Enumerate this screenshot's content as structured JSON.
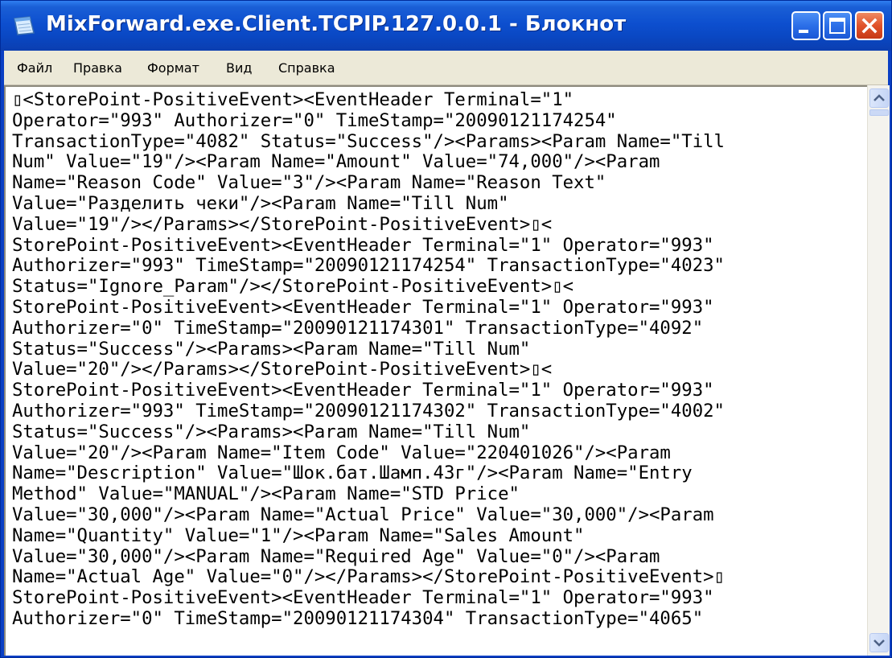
{
  "window": {
    "title": "MixForward.exe.Client.TCPIP.127.0.0.1 - Блокнот"
  },
  "menu": {
    "items": [
      "Файл",
      "Правка",
      "Формат",
      "Вид",
      "Справка"
    ]
  },
  "document": {
    "lines": [
      "▯<StorePoint-PositiveEvent><EventHeader Terminal=\"1\"",
      "Operator=\"993\" Authorizer=\"0\" TimeStamp=\"20090121174254\"",
      "TransactionType=\"4082\" Status=\"Success\"/><Params><Param Name=\"Till",
      "Num\" Value=\"19\"/><Param Name=\"Amount\" Value=\"74,000\"/><Param",
      "Name=\"Reason Code\" Value=\"3\"/><Param Name=\"Reason Text\"",
      "Value=\"Разделить чеки\"/><Param Name=\"Till Num\"",
      "Value=\"19\"/></Params></StorePoint-PositiveEvent>▯<",
      "StorePoint-PositiveEvent><EventHeader Terminal=\"1\" Operator=\"993\"",
      "Authorizer=\"993\" TimeStamp=\"20090121174254\" TransactionType=\"4023\"",
      "Status=\"Ignore_Param\"/></StorePoint-PositiveEvent>▯<",
      "StorePoint-PositiveEvent><EventHeader Terminal=\"1\" Operator=\"993\"",
      "Authorizer=\"0\" TimeStamp=\"20090121174301\" TransactionType=\"4092\"",
      "Status=\"Success\"/><Params><Param Name=\"Till Num\"",
      "Value=\"20\"/></Params></StorePoint-PositiveEvent>▯<",
      "StorePoint-PositiveEvent><EventHeader Terminal=\"1\" Operator=\"993\"",
      "Authorizer=\"993\" TimeStamp=\"20090121174302\" TransactionType=\"4002\"",
      "Status=\"Success\"/><Params><Param Name=\"Till Num\"",
      "Value=\"20\"/><Param Name=\"Item Code\" Value=\"220401026\"/><Param",
      "Name=\"Description\" Value=\"Шок.бат.Шамп.43г\"/><Param Name=\"Entry",
      "Method\" Value=\"MANUAL\"/><Param Name=\"STD Price\"",
      "Value=\"30,000\"/><Param Name=\"Actual Price\" Value=\"30,000\"/><Param",
      "Name=\"Quantity\" Value=\"1\"/><Param Name=\"Sales Amount\"",
      "Value=\"30,000\"/><Param Name=\"Required Age\" Value=\"0\"/><Param",
      "Name=\"Actual Age\" Value=\"0\"/></Params></StorePoint-PositiveEvent>▯",
      "StorePoint-PositiveEvent><EventHeader Terminal=\"1\" Operator=\"993\"",
      "Authorizer=\"0\" TimeStamp=\"20090121174304\" TransactionType=\"4065\""
    ]
  }
}
